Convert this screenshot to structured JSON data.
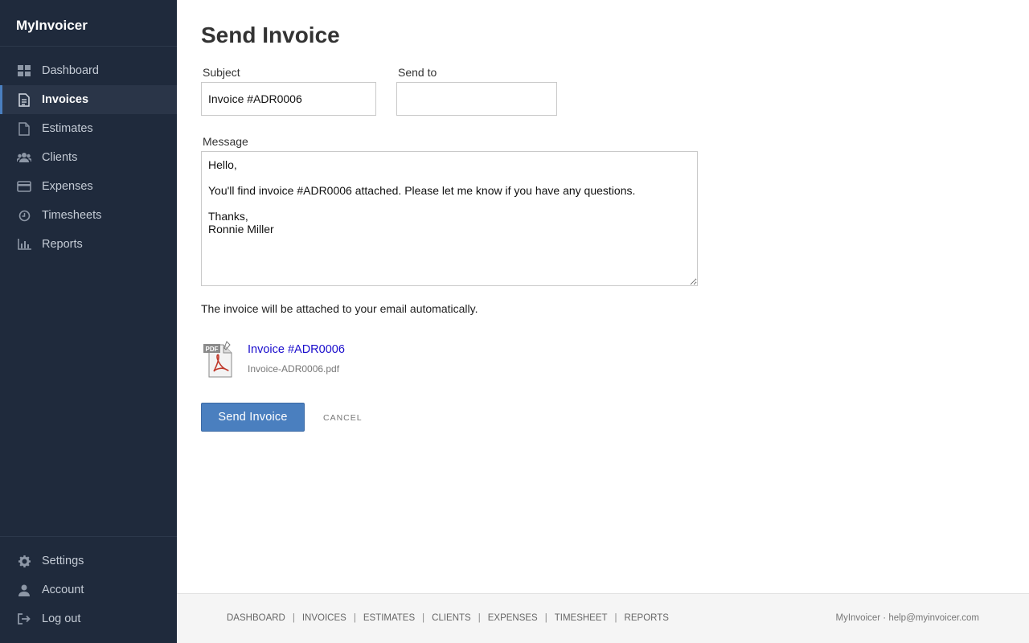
{
  "app": {
    "brand": "MyInvoicer"
  },
  "sidebar": {
    "items": [
      {
        "label": "Dashboard",
        "icon": "dashboard-icon"
      },
      {
        "label": "Invoices",
        "icon": "document-icon",
        "active": true
      },
      {
        "label": "Estimates",
        "icon": "file-icon"
      },
      {
        "label": "Clients",
        "icon": "users-icon"
      },
      {
        "label": "Expenses",
        "icon": "credit-card-icon"
      },
      {
        "label": "Timesheets",
        "icon": "clock-icon"
      },
      {
        "label": "Reports",
        "icon": "bar-chart-icon"
      }
    ],
    "bottom_items": [
      {
        "label": "Settings",
        "icon": "gear-icon"
      },
      {
        "label": "Account",
        "icon": "user-icon"
      },
      {
        "label": "Log out",
        "icon": "logout-icon"
      }
    ]
  },
  "page": {
    "title": "Send Invoice",
    "subject_label": "Subject",
    "subject_value": "Invoice #ADR0006",
    "sendto_label": "Send to",
    "sendto_value": "",
    "message_label": "Message",
    "message_value": "Hello,\n\nYou'll find invoice #ADR0006 attached. Please let me know if you have any questions.\n\nThanks,\nRonnie Miller",
    "note": "The invoice will be attached to your email automatically.",
    "attachment": {
      "title": "Invoice #ADR0006",
      "filename": "Invoice-ADR0006.pdf",
      "icon": "pdf-file-icon",
      "badge": "PDF"
    },
    "send_button": "Send Invoice",
    "cancel_button": "CANCEL"
  },
  "footer": {
    "links": [
      "DASHBOARD",
      "INVOICES",
      "ESTIMATES",
      "CLIENTS",
      "EXPENSES",
      "TIMESHEET",
      "REPORTS"
    ],
    "separator": "|",
    "right_text": "MyInvoicer · help@myinvoicer.com"
  },
  "colors": {
    "sidebar_bg": "#1f2a3c",
    "active_bar": "#4a7fc0",
    "primary_button": "#4a7fbf",
    "link": "#1a0dcc"
  }
}
